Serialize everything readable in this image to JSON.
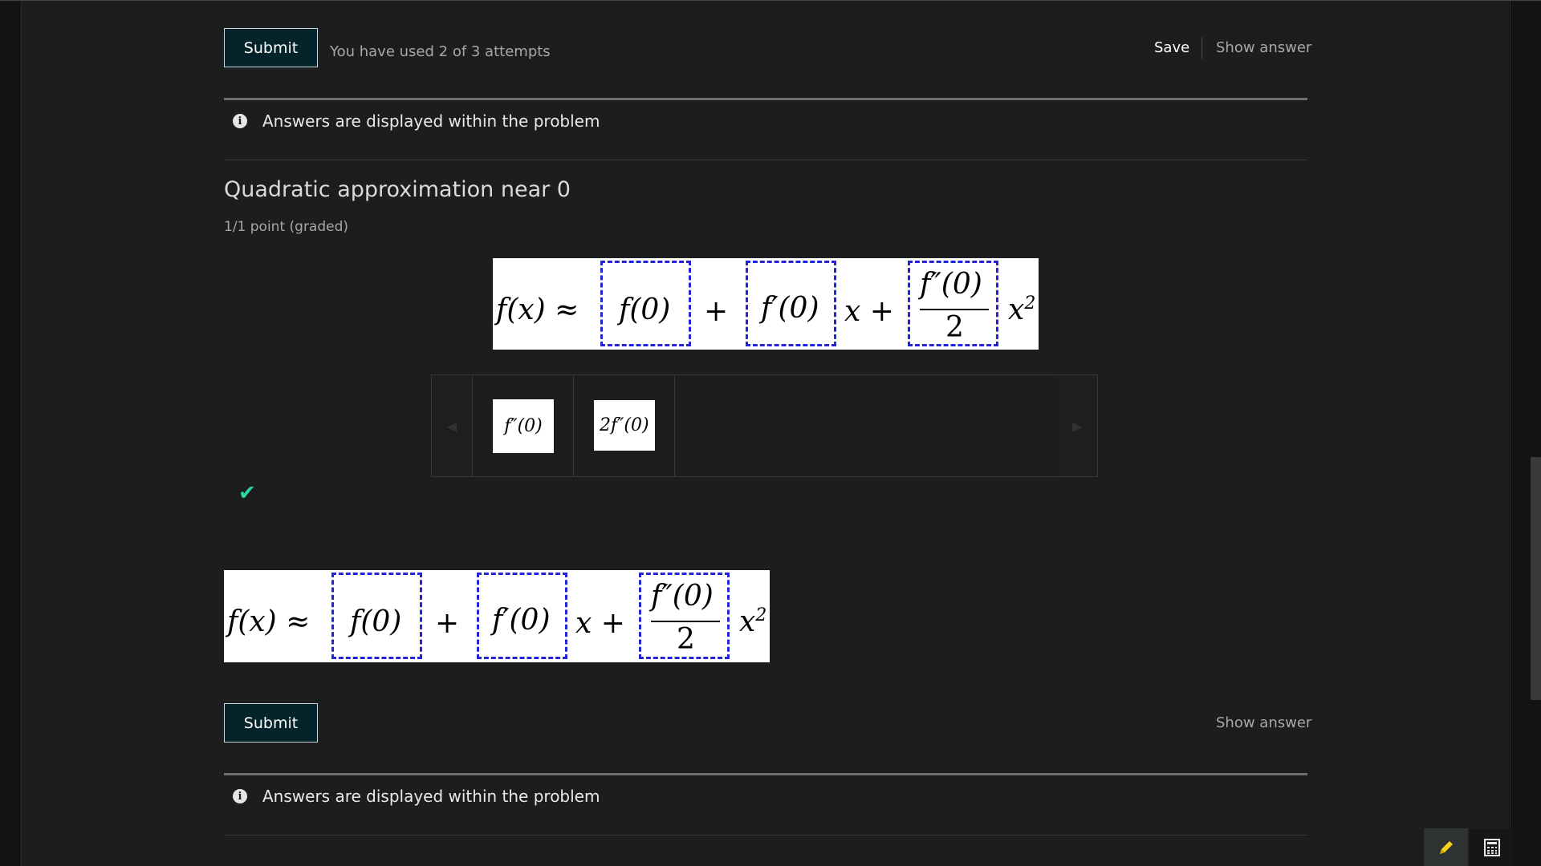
{
  "problem1": {
    "submit_label": "Submit",
    "attempts_text": "You have used 2 of 3 attempts",
    "save_label": "Save",
    "show_answer_label": "Show answer",
    "info_text": "Answers are displayed within the problem"
  },
  "problem2": {
    "title": "Quadratic approximation near 0",
    "points": "1/1 point (graded)",
    "equation": {
      "lhs": "f(x) ≈",
      "box1": "f(0)",
      "plus1": "+",
      "box2": "f′(0)",
      "x_plus": "x +",
      "box3_num": "f″(0)",
      "box3_den": "2",
      "tail_base": "x",
      "tail_exp": "2"
    },
    "tray_options": [
      "f″(0)",
      "2f″(0)"
    ],
    "status_icon": "checkmark-icon",
    "status_color": "#2ed8a3",
    "answer_equation": {
      "lhs": "f(x) ≈",
      "box1": "f(0)",
      "plus1": "+",
      "box2": "f′(0)",
      "x_plus": "x +",
      "box3_num": "f″(0)",
      "box3_den": "2",
      "tail_base": "x",
      "tail_exp": "2"
    },
    "submit_label": "Submit",
    "show_answer_label": "Show answer",
    "info_text": "Answers are displayed within the problem"
  },
  "tools": {
    "notes_icon": "pencil-icon",
    "calculator_icon": "calculator-icon",
    "notes_color": "#f5d31b"
  }
}
